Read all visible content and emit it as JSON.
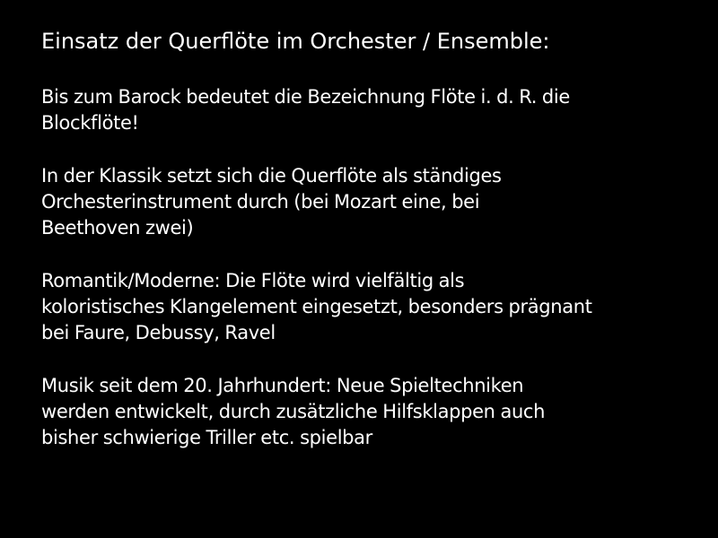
{
  "slide": {
    "title": "Einsatz der Querflöte  im Orchester / Ensemble:",
    "paragraphs": [
      {
        "lines": [
          "Bis zum Barock bedeutet die Bezeichnung Flöte i. d. R. die",
          "Blockflöte!"
        ]
      },
      {
        "lines": [
          "In der Klassik setzt sich die Querflöte als ständiges",
          "Orchesterinstrument durch (bei Mozart eine, bei",
          "Beethoven zwei)"
        ]
      },
      {
        "lines": [
          "Romantik/Moderne: Die Flöte wird vielfältig als",
          "koloristisches Klangelement eingesetzt, besonders prägnant",
          "bei Faure, Debussy, Ravel"
        ]
      },
      {
        "lines": [
          "Musik seit dem 20. Jahrhundert: Neue Spieltechniken",
          "werden entwickelt, durch zusätzliche Hilfsklappen auch",
          "bisher schwierige Triller etc. spielbar"
        ]
      }
    ],
    "colors": {
      "background": "#000000",
      "text": "#ffffff"
    }
  }
}
